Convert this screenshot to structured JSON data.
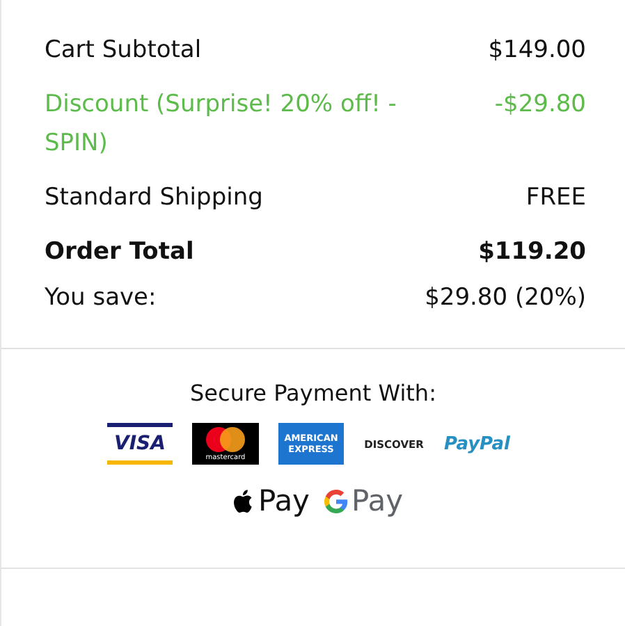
{
  "summary": [
    {
      "kind": "normal",
      "label": "Cart Subtotal",
      "value": "$149.00"
    },
    {
      "kind": "discount",
      "label": "Discount (Surprise! 20% off! - SPIN)",
      "value": "-$29.80"
    },
    {
      "kind": "normal",
      "label": "Standard Shipping",
      "value": "FREE"
    },
    {
      "kind": "total",
      "label": "Order Total",
      "value": "$119.20"
    },
    {
      "kind": "normal",
      "label": "You save:",
      "value": "$29.80 (20%)"
    }
  ],
  "payment": {
    "heading": "Secure Payment With:",
    "cards": [
      {
        "kind": "visa",
        "text": "VISA"
      },
      {
        "kind": "mastercard",
        "text": "mastercard"
      },
      {
        "kind": "amex",
        "text": "AMERICAN EXPRESS"
      },
      {
        "kind": "discover",
        "text": "DISCOVER"
      },
      {
        "kind": "paypal",
        "text": "PayPal"
      }
    ],
    "wallets": [
      {
        "kind": "apple",
        "text": "Pay"
      },
      {
        "kind": "google",
        "text": "Pay"
      }
    ]
  }
}
